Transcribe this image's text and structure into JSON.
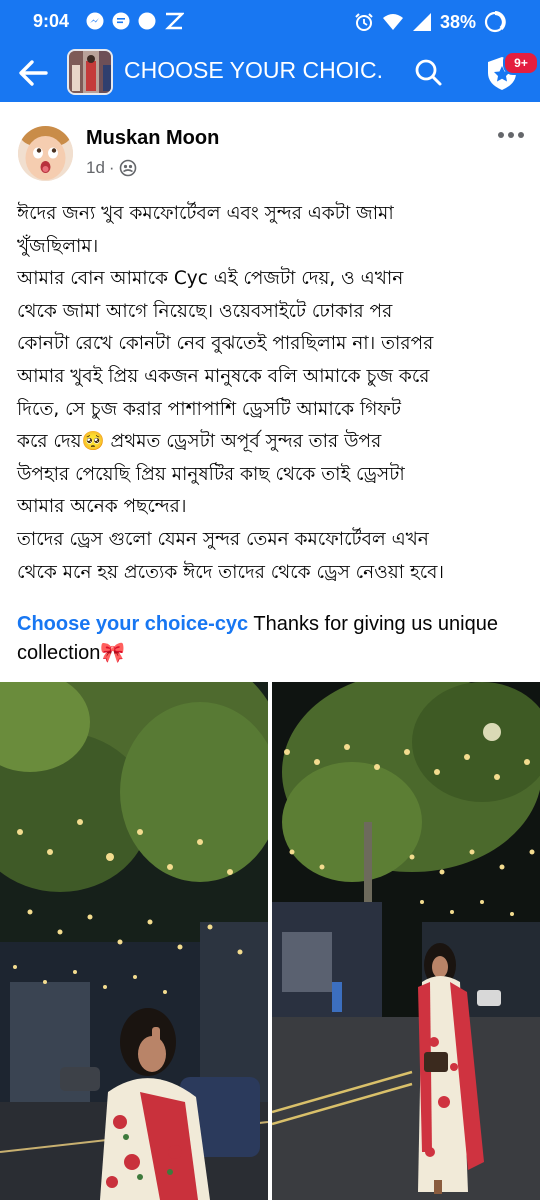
{
  "status_bar": {
    "time": "9:04",
    "battery": "38%",
    "left_icons": [
      "messenger-icon",
      "chat-bubble-icon",
      "dot-icon",
      "zero-rating-icon"
    ],
    "right_icons": [
      "alarm-icon",
      "wifi-icon",
      "signal-icon",
      "battery-icon"
    ]
  },
  "app_bar": {
    "title": "CHOOSE YOUR CHOIC...",
    "badge": "9+",
    "color": "#1877f2"
  },
  "post": {
    "author": "Muskan Moon",
    "time": "1d",
    "separator": "·",
    "privacy_icon": "friends-icon",
    "body": "ঈদের জন্য খুব কমফোর্টেবল এবং সুন্দর একটা জামা\nখুঁজছিলাম।\nআমার বোন আমাকে Cyc এই পেজটা দেয়, ও এখান\nথেকে জামা আগে নিয়েছে। ওয়েবসাইটে ঢোকার পর\nকোনটা রেখে কোনটা নেব বুঝতেই পারছিলাম না। তারপর\nআমার খুবই প্রিয় একজন মানুষকে বলি আমাকে চুজ করে\nদিতে, সে চুজ করার পাশাপাশি ড্রেসটি আমাকে গিফট\nকরে দেয়🥺 প্রথমত ড্রেসটা অপূর্ব সুন্দর তার উপর\nউপহার পেয়েছি প্রিয় মানুষটির কাছ থেকে তাই ড্রেসটা\nআমার অনেক পছন্দের।\nতাদের ড্রেস গুলো যেমন সুন্দর তেমন কমফোর্টেবল এখন\nথেকে মনে হয় প্রত্যেক ঈদে তাদের থেকে ড্রেস নেওয়া হবে।",
    "caption_link": "Choose your choice-cyc",
    "caption_text": " Thanks for giving us unique collection🎀"
  }
}
